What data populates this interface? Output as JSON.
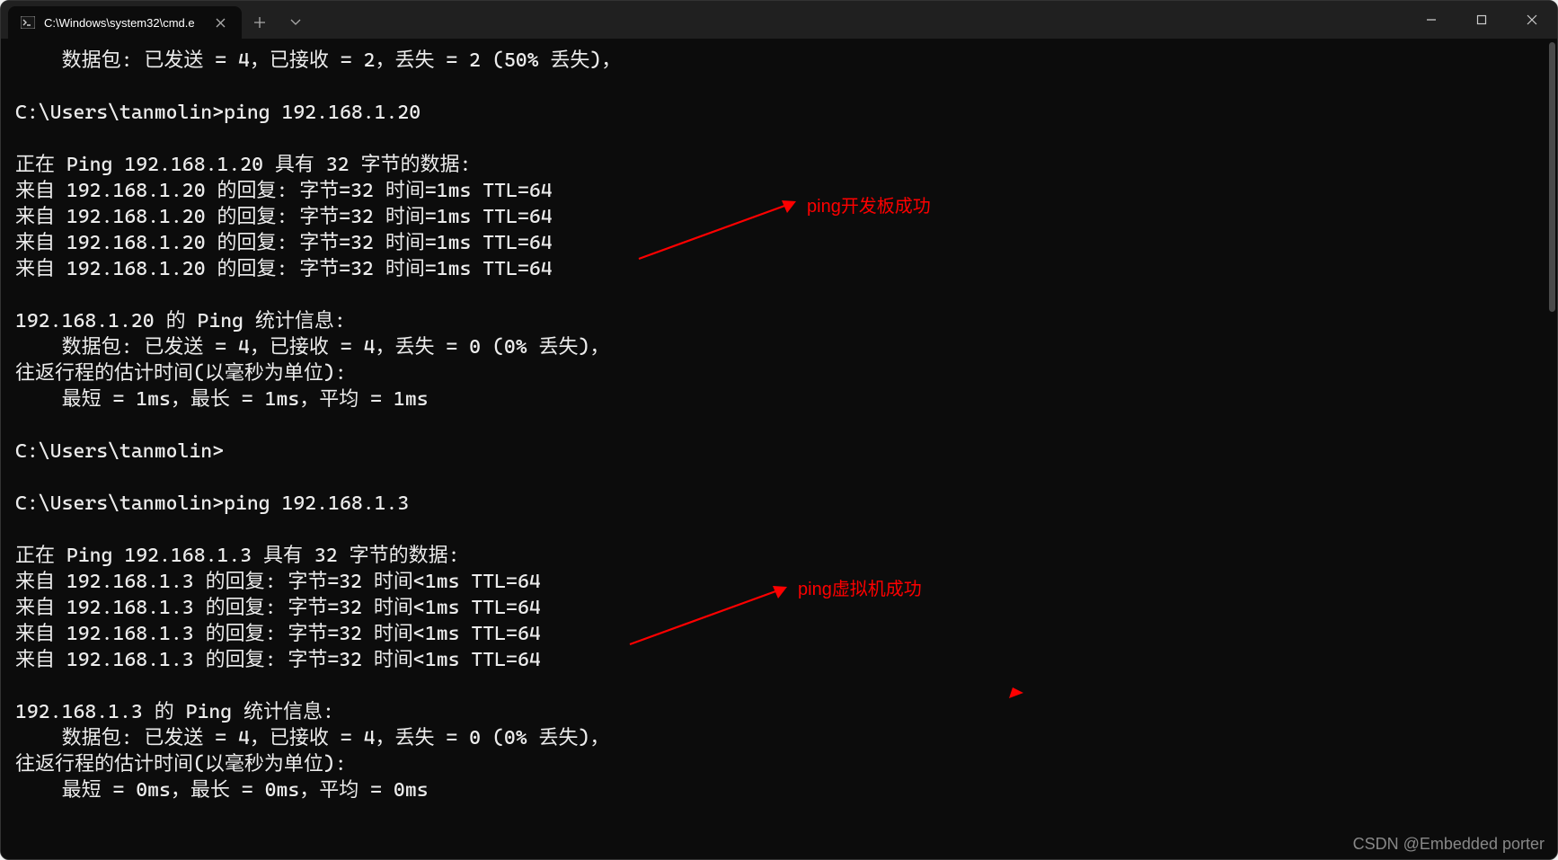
{
  "window": {
    "tab_title": "C:\\Windows\\system32\\cmd.e"
  },
  "terminal": {
    "lines": [
      "    数据包: 已发送 = 4，已接收 = 2，丢失 = 2 (50% 丢失)，",
      "",
      "C:\\Users\\tanmolin>ping 192.168.1.20",
      "",
      "正在 Ping 192.168.1.20 具有 32 字节的数据:",
      "来自 192.168.1.20 的回复: 字节=32 时间=1ms TTL=64",
      "来自 192.168.1.20 的回复: 字节=32 时间=1ms TTL=64",
      "来自 192.168.1.20 的回复: 字节=32 时间=1ms TTL=64",
      "来自 192.168.1.20 的回复: 字节=32 时间=1ms TTL=64",
      "",
      "192.168.1.20 的 Ping 统计信息:",
      "    数据包: 已发送 = 4，已接收 = 4，丢失 = 0 (0% 丢失)，",
      "往返行程的估计时间(以毫秒为单位):",
      "    最短 = 1ms，最长 = 1ms，平均 = 1ms",
      "",
      "C:\\Users\\tanmolin>",
      "",
      "C:\\Users\\tanmolin>ping 192.168.1.3",
      "",
      "正在 Ping 192.168.1.3 具有 32 字节的数据:",
      "来自 192.168.1.3 的回复: 字节=32 时间<1ms TTL=64",
      "来自 192.168.1.3 的回复: 字节=32 时间<1ms TTL=64",
      "来自 192.168.1.3 的回复: 字节=32 时间<1ms TTL=64",
      "来自 192.168.1.3 的回复: 字节=32 时间<1ms TTL=64",
      "",
      "192.168.1.3 的 Ping 统计信息:",
      "    数据包: 已发送 = 4，已接收 = 4，丢失 = 0 (0% 丢失)，",
      "往返行程的估计时间(以毫秒为单位):",
      "    最短 = 0ms，最长 = 0ms，平均 = 0ms"
    ]
  },
  "annotations": {
    "label1": "ping开发板成功",
    "label2": "ping虚拟机成功"
  },
  "watermark": {
    "text": "CSDN @Embedded porter"
  }
}
